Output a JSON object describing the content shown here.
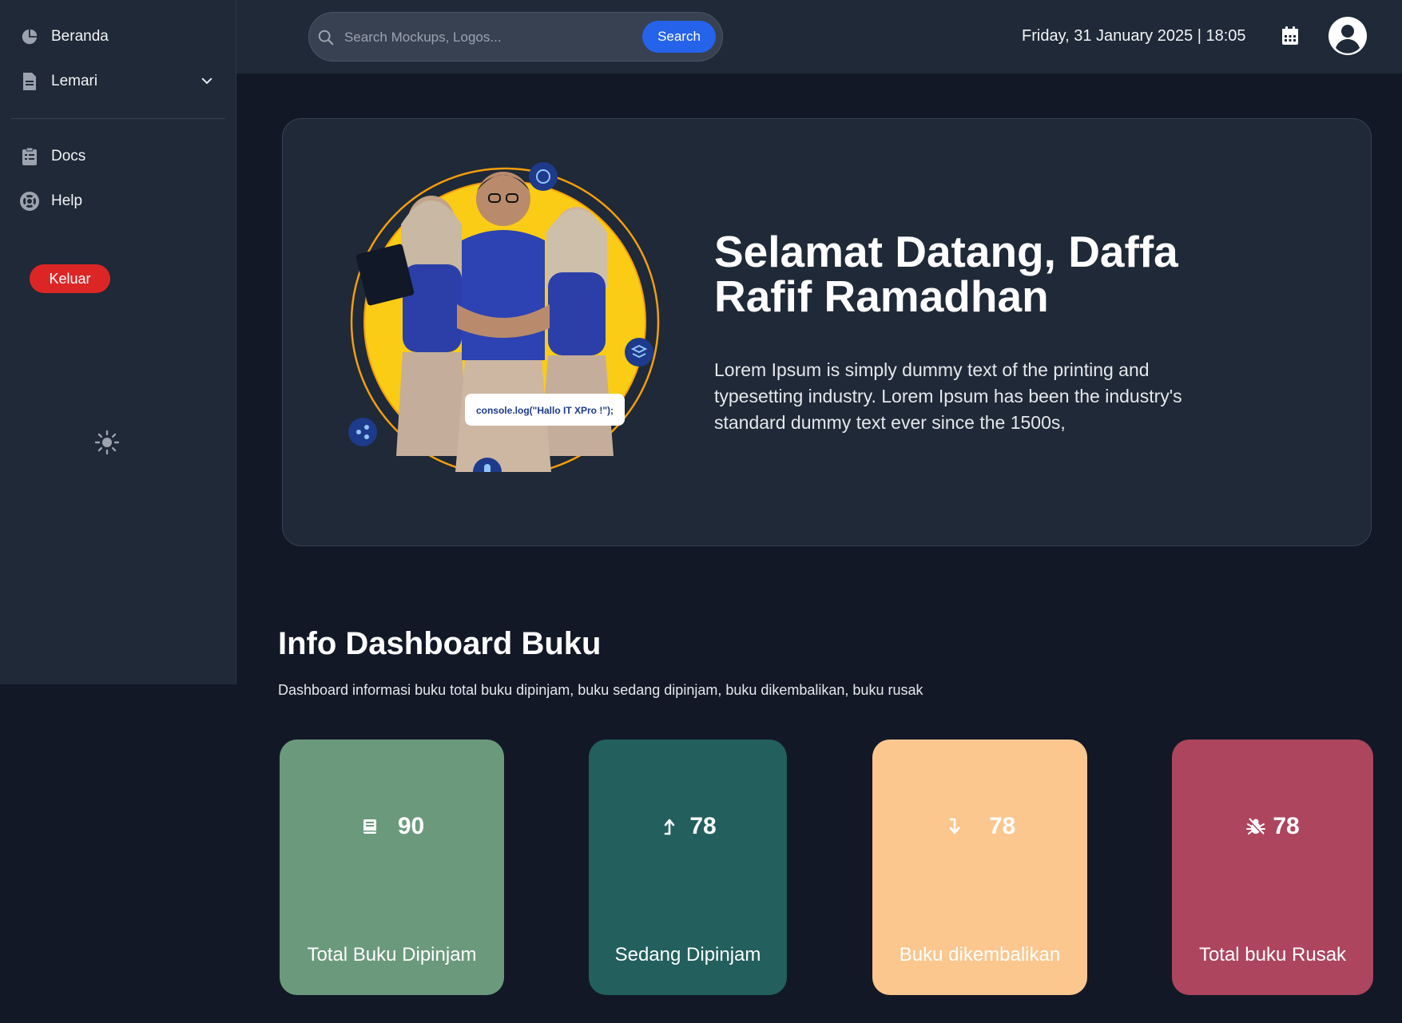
{
  "sidebar": {
    "items": [
      {
        "label": "Beranda",
        "icon": "pie-chart-icon"
      },
      {
        "label": "Lemari",
        "icon": "document-icon"
      },
      {
        "label": "Docs",
        "icon": "clipboard-icon"
      },
      {
        "label": "Help",
        "icon": "lifebuoy-icon"
      }
    ],
    "logout_label": "Keluar"
  },
  "topbar": {
    "search_placeholder": "Search Mockups, Logos...",
    "search_button": "Search",
    "datetime": "Friday, 31 January 2025 | 18:05"
  },
  "hero": {
    "title": "Selamat Datang, Daffa Rafif Ramadhan",
    "description": "Lorem Ipsum is simply dummy text of the printing and typesetting industry. Lorem Ipsum has been the industry's standard dummy text ever since the 1500s,",
    "badge_code": "console.log(\"Hallo IT XPro !\");"
  },
  "dashboard": {
    "title": "Info Dashboard Buku",
    "subtitle": "Dashboard informasi buku total buku dipinjam, buku sedang dipinjam, buku dikembalikan, buku rusak",
    "cards": [
      {
        "value": "90",
        "label": "Total Buku Dipinjam",
        "icon": "book-icon",
        "color": "#6b997c"
      },
      {
        "value": "78",
        "label": "Sedang Dipinjam",
        "icon": "arrow-up-icon",
        "color": "#225f5d"
      },
      {
        "value": "78",
        "label": "Buku dikembalikan",
        "icon": "arrow-down-icon",
        "color": "#fbc78f"
      },
      {
        "value": "78",
        "label": "Total buku Rusak",
        "icon": "bug-icon",
        "color": "#ad455e"
      }
    ]
  },
  "colors": {
    "sidebar_bg": "#1f2937",
    "page_bg": "#121826",
    "accent_blue": "#2563eb",
    "logout_red": "#dc2626"
  }
}
